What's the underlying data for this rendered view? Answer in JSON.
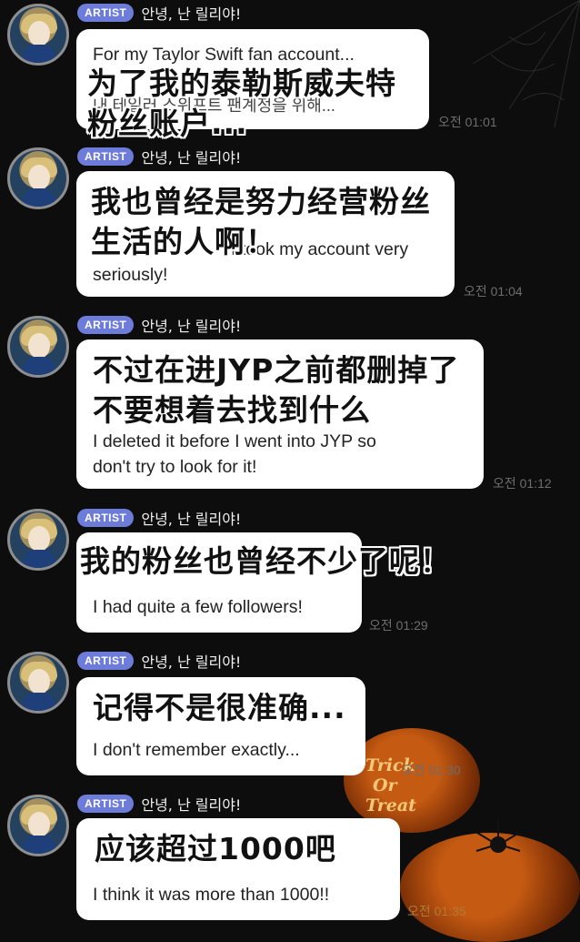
{
  "messages": [
    {
      "badge": "ARTIST",
      "sender": "안녕, 난 릴리야!",
      "zh": [
        "为了我的泰勒斯威夫特",
        "粉丝账户..."
      ],
      "en": [
        "For my Taylor Swift fan account...",
        "내 테일러 스위프트 팬계정을 위해..."
      ],
      "time": "오전 01:01"
    },
    {
      "badge": "ARTIST",
      "sender": "안녕, 난 릴리야!",
      "zh": [
        "我也曾经是努力经营粉丝",
        "生活的人啊！"
      ],
      "en": [
        "I took my account very",
        "seriously!"
      ],
      "time": "오전 01:04"
    },
    {
      "badge": "ARTIST",
      "sender": "안녕, 난 릴리야!",
      "zh": [
        "不过在进JYP之前都删掉了",
        "不要想着去找到什么"
      ],
      "en": [
        "I deleted it before I went into JYP so",
        "don't try to look for it!"
      ],
      "time": "오전 01:12"
    },
    {
      "badge": "ARTIST",
      "sender": "안녕, 난 릴리야!",
      "zh": [
        "我的粉丝也曾经不少了呢！"
      ],
      "en": [
        "I had quite a few followers!"
      ],
      "time": "오전 01:29"
    },
    {
      "badge": "ARTIST",
      "sender": "안녕, 난 릴리야!",
      "zh": [
        "记得不是很准确..."
      ],
      "en": [
        "I don't remember exactly..."
      ],
      "time": "오전 01:30"
    },
    {
      "badge": "ARTIST",
      "sender": "안녕, 난 릴리야!",
      "zh": [
        "应该超过1000吧"
      ],
      "en": [
        "I think it was more than 1000!!"
      ],
      "time": "오전 01:35"
    }
  ],
  "decor": {
    "pumpkin_text": [
      "Trick",
      "Or",
      "Treat"
    ]
  }
}
